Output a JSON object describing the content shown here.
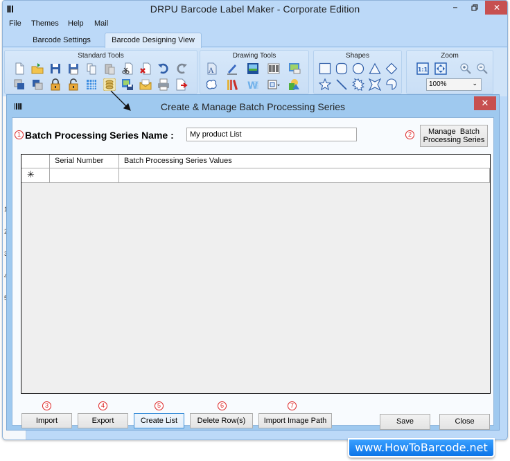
{
  "window": {
    "title": "DRPU Barcode Label Maker - Corporate Edition",
    "minimize_icon": "minimize-icon",
    "maximize_icon": "restore-icon",
    "close_glyph": "✕"
  },
  "menu": [
    "File",
    "Themes",
    "Help",
    "Mail"
  ],
  "tabs": [
    {
      "label": "Barcode Settings",
      "active": false
    },
    {
      "label": "Barcode Designing View",
      "active": true
    }
  ],
  "ribbon": {
    "groups": [
      {
        "title": "Standard Tools",
        "row1": [
          "new-icon",
          "open-icon",
          "save-icon",
          "save-as-icon",
          "copy-icon",
          "paste-icon",
          "cut-icon",
          "delete-icon",
          "undo-icon",
          "redo-icon"
        ],
        "row2": [
          "send-back-icon",
          "bring-front-icon",
          "lock-icon",
          "unlock-icon",
          "grid-icon",
          "batch-processing-icon",
          "image-save-icon",
          "mail-icon",
          "print-icon",
          "export-icon"
        ]
      },
      {
        "title": "Drawing Tools",
        "row1": [
          "text-icon",
          "pencil-icon",
          "picture-icon",
          "barcode-icon",
          "image-library-icon"
        ],
        "row2": [
          "shape-blob-icon",
          "books-icon",
          "watermark-icon",
          "align-dropdown-icon",
          "fill-dropdown-icon"
        ]
      },
      {
        "title": "Shapes",
        "row1": [
          "rectangle-icon",
          "rounded-rectangle-icon",
          "ellipse-icon",
          "triangle-icon",
          "diamond-icon"
        ],
        "row2": [
          "star-icon",
          "line-icon",
          "burst-icon",
          "four-point-star-icon",
          "arc-icon"
        ]
      },
      {
        "title": "Zoom",
        "row1": [
          "actual-size-icon",
          "fit-to-window-icon",
          "zoom-in-icon",
          "zoom-out-icon"
        ],
        "zoom_value": "100%"
      }
    ]
  },
  "ruler": [
    "1",
    "2",
    "3",
    "4",
    "5"
  ],
  "dialog": {
    "title": "Create & Manage Batch Processing Series",
    "close_glyph": "✕",
    "name_label": "Batch Processing Series Name :",
    "name_value": "My product List",
    "manage_button": "Manage  Batch Processing Series",
    "grid": {
      "columns": [
        "",
        "Serial Number",
        "Batch Processing Series Values"
      ],
      "new_row_marker": "✳",
      "rows": []
    },
    "buttons": {
      "import": "Import",
      "export": "Export",
      "create_list": "Create List",
      "delete_rows": "Delete Row(s)",
      "import_image_path": "Import Image Path",
      "save": "Save",
      "close": "Close"
    },
    "badges": [
      "1",
      "2",
      "3",
      "4",
      "5",
      "6",
      "7"
    ]
  },
  "watermark": "www.HowToBarcode.net"
}
